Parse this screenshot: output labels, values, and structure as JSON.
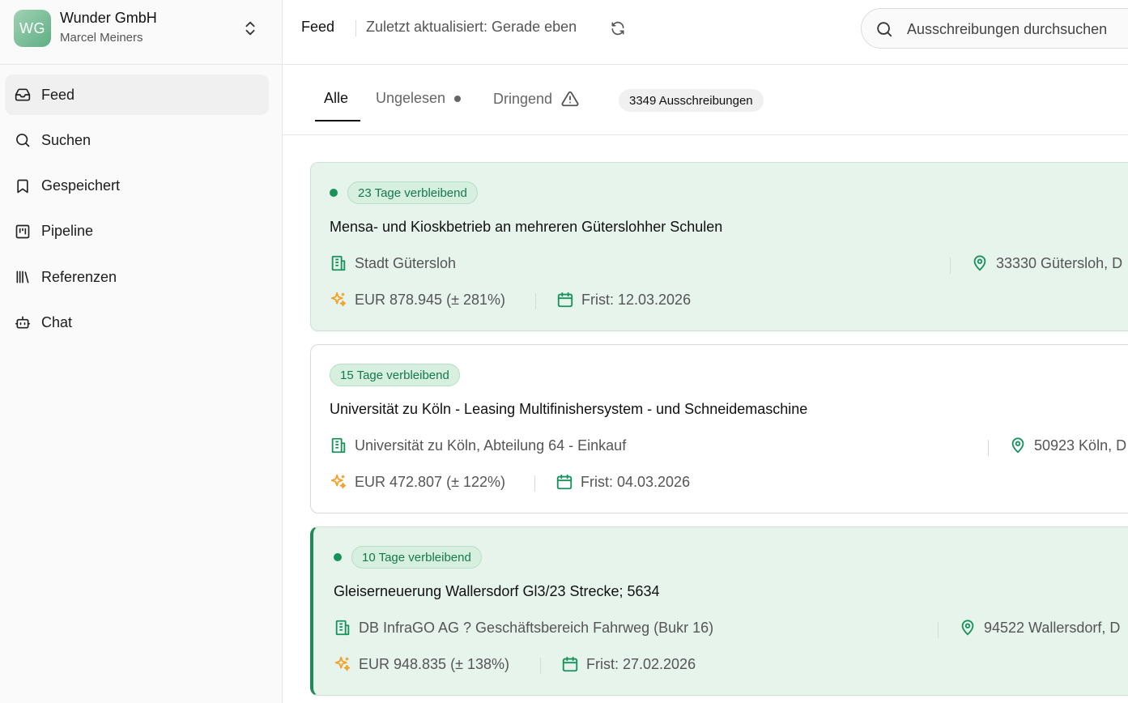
{
  "org": {
    "initials": "WG",
    "name": "Wunder GmbH",
    "user": "Marcel Meiners"
  },
  "nav": {
    "items": [
      {
        "label": "Feed",
        "icon": "inbox-icon",
        "active": true
      },
      {
        "label": "Suchen",
        "icon": "search-icon"
      },
      {
        "label": "Gespeichert",
        "icon": "bookmark-icon"
      },
      {
        "label": "Pipeline",
        "icon": "kanban-icon"
      },
      {
        "label": "Referenzen",
        "icon": "library-icon"
      },
      {
        "label": "Chat",
        "icon": "bot-icon"
      }
    ]
  },
  "header": {
    "crumb": "Feed",
    "updated": "Zuletzt aktualisiert: Gerade eben",
    "search_placeholder": "Ausschreibungen durchsuchen"
  },
  "tabs": {
    "all": "Alle",
    "unread": "Ungelesen",
    "urgent": "Dringend",
    "count": "3349 Ausschreibungen"
  },
  "colors": {
    "accent": "#17925b",
    "unread_bg": "#e6f4ec",
    "sparkle": "#f0a22a"
  },
  "cards": [
    {
      "days": "23 Tage verbleibend",
      "title": "Mensa- und Kioskbetrieb an mehreren Güterslohher Schulen",
      "authority": "Stadt Gütersloh",
      "location": "33330 Gütersloh, D",
      "value": "EUR 878.945 (± 281%)",
      "deadline": "Frist: 12.03.2026"
    },
    {
      "days": "15 Tage verbleibend",
      "title": "Universität zu Köln - Leasing Multifinishersystem - und Schneidemaschine",
      "authority": "Universität zu Köln, Abteilung 64 - Einkauf",
      "location": "50923 Köln, D",
      "value": "EUR 472.807 (± 122%)",
      "deadline": "Frist: 04.03.2026"
    },
    {
      "days": "10 Tage verbleibend",
      "title": "Gleiserneuerung Wallersdorf Gl3/23 Strecke; 5634",
      "authority": "DB InfraGO AG ? Geschäftsbereich Fahrweg (Bukr 16)",
      "location": "94522 Wallersdorf, D",
      "value": "EUR 948.835 (± 138%)",
      "deadline": "Frist: 27.02.2026"
    }
  ]
}
